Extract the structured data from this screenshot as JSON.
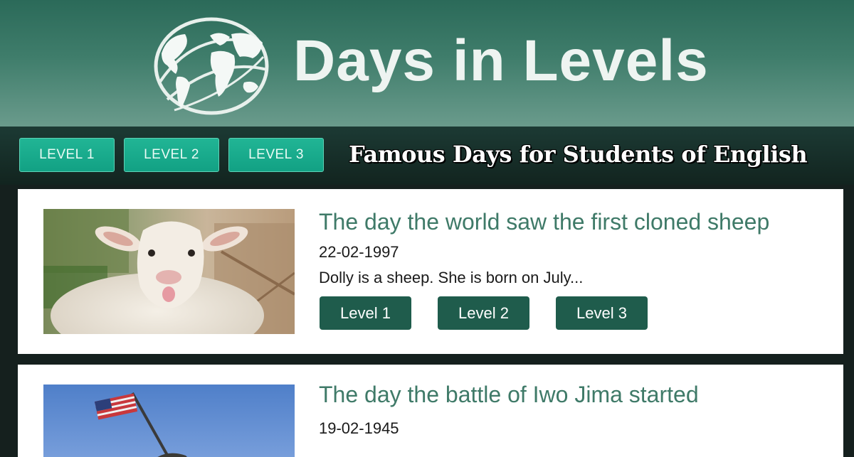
{
  "header": {
    "site_title": "Days in Levels",
    "logo_icon": "globe-icon"
  },
  "nav": {
    "buttons": [
      {
        "label": "LEVEL 1"
      },
      {
        "label": "LEVEL 2"
      },
      {
        "label": "LEVEL 3"
      }
    ],
    "tagline": "Famous Days for Students of English"
  },
  "articles": [
    {
      "title": "The day the world saw the first cloned sheep",
      "date": "22-02-1997",
      "excerpt": "Dolly is a sheep. She is born on July...",
      "levels": [
        "Level 1",
        "Level 2",
        "Level 3"
      ],
      "image": "sheep-photo"
    },
    {
      "title": "The day the battle of Iwo Jima started",
      "date": "19-02-1945",
      "image": "iwo-jima-flag-photo"
    }
  ],
  "colors": {
    "header_green": "#3f7d6b",
    "nav_button": "#16a88a",
    "level_button": "#1f5c4c",
    "title_green": "#3f7a68"
  }
}
